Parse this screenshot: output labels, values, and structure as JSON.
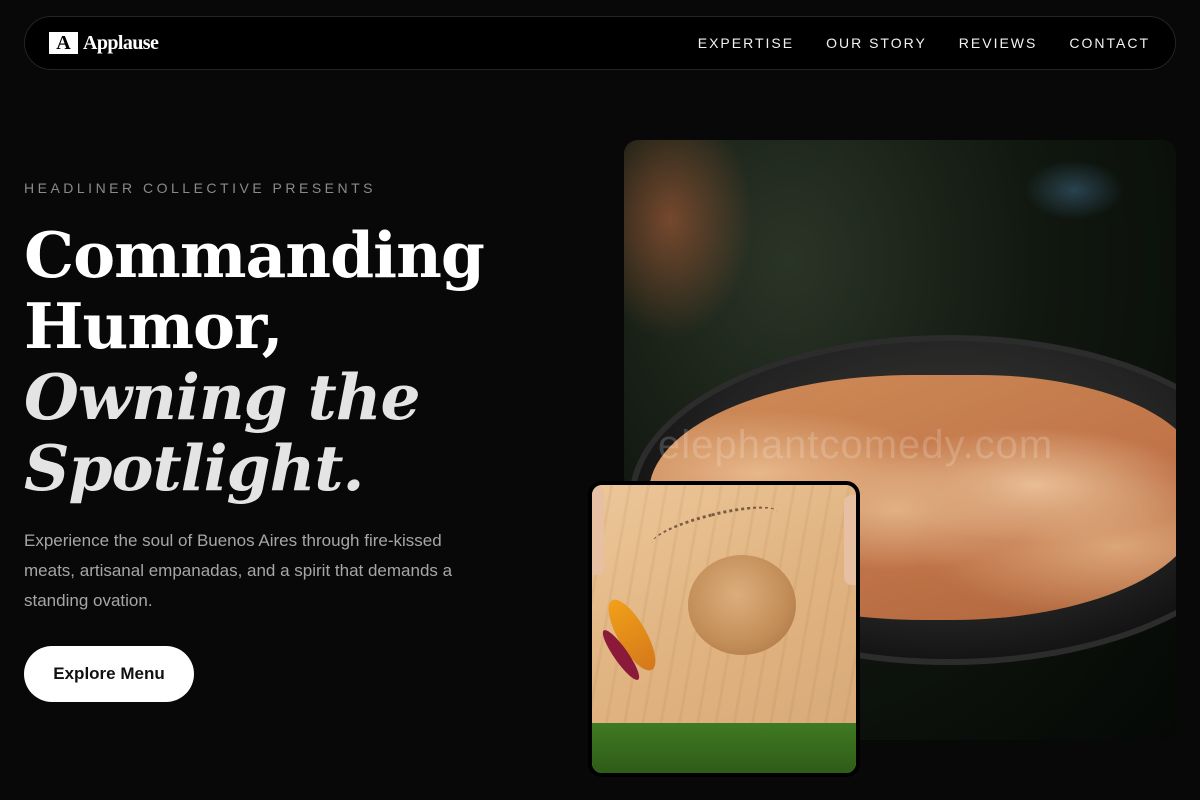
{
  "brand": {
    "mark": "A",
    "name": "Applause"
  },
  "nav": {
    "links": [
      "EXPERTISE",
      "OUR STORY",
      "REVIEWS",
      "CONTACT"
    ]
  },
  "hero": {
    "eyebrow": "HEADLINER COLLECTIVE PRESENTS",
    "headline": {
      "line1": "Commanding",
      "line2": "Humor,",
      "line3": "Owning the",
      "line4": "Spotlight."
    },
    "lede": "Experience the soul of Buenos Aires through fire-kissed meats, artisanal empanadas, and a spirit that demands a standing ovation.",
    "cta_label": "Explore Menu"
  },
  "images": {
    "main_watermark": "elephantcomedy.com",
    "main_alt": "empanadas-photo",
    "inset_alt": "burger-photo"
  },
  "colors": {
    "background": "#080808",
    "text": "#ffffff",
    "muted": "#8a8a8a",
    "cta_bg": "#ffffff"
  }
}
